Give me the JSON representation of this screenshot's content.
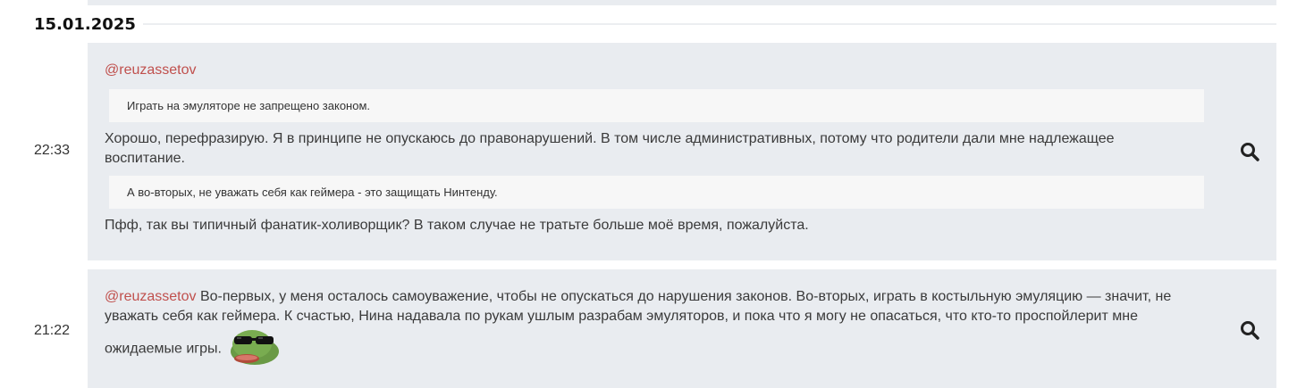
{
  "date_header": "15.01.2025",
  "messages": [
    {
      "time": "22:33",
      "author": "@reuzassetov",
      "quote1": "Играть на эмуляторе не запрещено законом.",
      "text1": "Хорошо, перефразирую. Я в принципе не опускаюсь до правонарушений. В том числе административных, потому что родители дали мне надлежащее воспитание.",
      "quote2": "А во-вторых, не уважать себя как геймера - это защищать Нинтенду.",
      "text2": "Пфф, так вы типичный фанатик-холиворщик? В таком случае не тратьте больше моё время, пожалуйста."
    },
    {
      "time": "21:22",
      "author": "@reuzassetov",
      "text": " Во-первых, у меня осталось самоуважение, чтобы не опускаться до нарушения законов. Во-вторых, играть в костыльную эмуляцию — значит, не уважать себя как геймера. К счастью, Нина надавала по рукам ушлым разрабам эмуляторов, и пока что я могу не опасаться, что кто-то проспойлерит мне ожидаемые игры.",
      "emoji": "pepe-sunglasses-emoji"
    }
  ],
  "icons": {
    "search": "search-icon"
  },
  "colors": {
    "card_bg": "#e9ecf0",
    "quote_bg": "#f7f7f7",
    "mention": "#c0504d"
  }
}
